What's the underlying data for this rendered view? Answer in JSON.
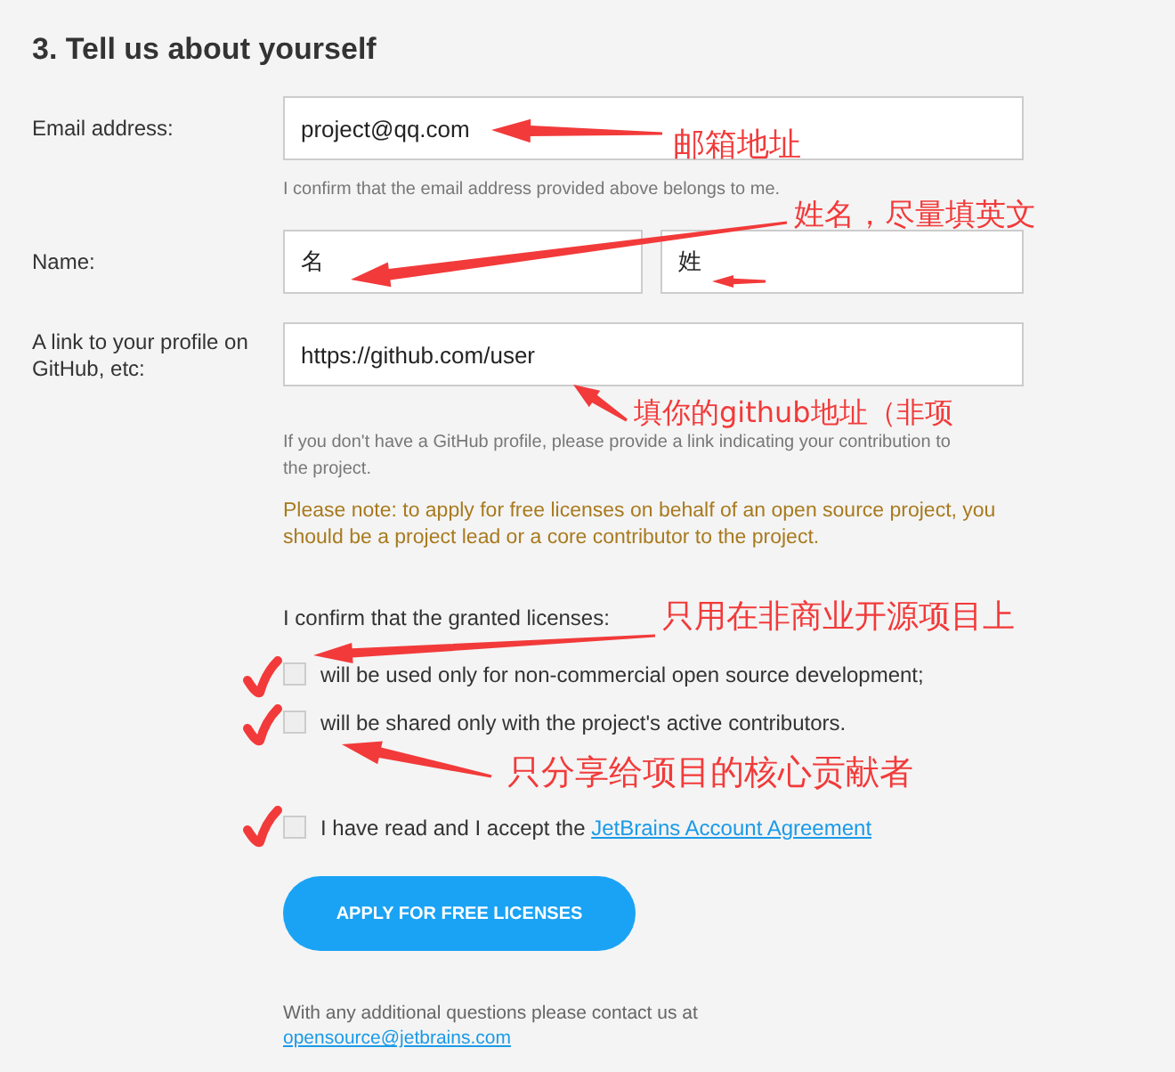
{
  "heading": "3. Tell us about yourself",
  "email": {
    "label": "Email address:",
    "value": "project@qq.com",
    "hint": "I confirm that the email address provided above belongs to me."
  },
  "name": {
    "label": "Name:",
    "first": "名",
    "last": "姓"
  },
  "github": {
    "label": "A link to your profile on GitHub, etc:",
    "value": "https://github.com/user",
    "hint": "If you don't have a GitHub profile, please provide a link indicating your contribution to the project."
  },
  "note": "Please note: to apply for free licenses on behalf of an open source project, you should be a project lead or a core contributor to the project.",
  "confirm": "I confirm that the granted licenses:",
  "checkboxes": [
    {
      "label": "will be used only for non-commercial open source development;",
      "checked": false
    },
    {
      "label": "will be shared only with the project's active contributors.",
      "checked": false
    }
  ],
  "agreement": {
    "text": "I have read and I accept the ",
    "link": "JetBrains Account Agreement",
    "checked": false
  },
  "button": "APPLY FOR FREE LICENSES",
  "footer": {
    "text": "With any additional questions please contact us at",
    "link": "opensource@jetbrains.com"
  },
  "annotations": [
    "邮箱地址",
    "姓名，尽量填英文",
    "填你的github地址（非项",
    "只用在非商业开源项目上",
    "只分享给项目的核心贡献者"
  ]
}
